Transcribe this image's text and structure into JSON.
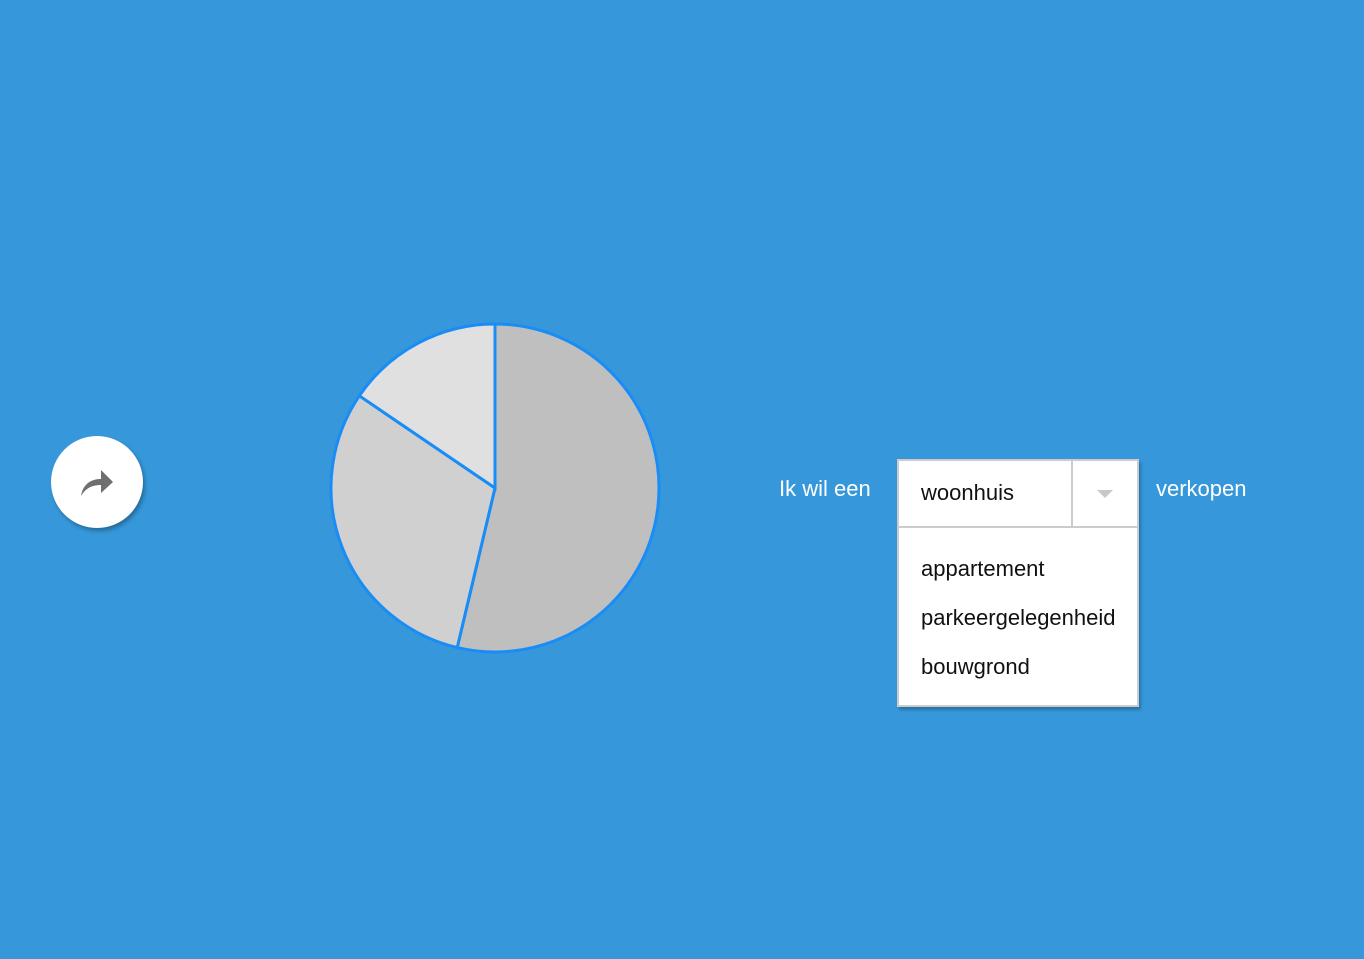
{
  "share_button": {
    "icon": "share-forward-icon"
  },
  "chart_data": {
    "type": "pie",
    "values": [
      53.7,
      30.8,
      15.5
    ],
    "colors": [
      "#bfbfbf",
      "#d0d0d0",
      "#e0e0e0"
    ],
    "stroke": "#1a8cf5"
  },
  "sentence": {
    "prefix": "Ik wil een",
    "suffix": "verkopen",
    "selected": "woonhuis",
    "options": [
      "appartement",
      "parkeergelegenheid",
      "bouwgrond"
    ]
  }
}
